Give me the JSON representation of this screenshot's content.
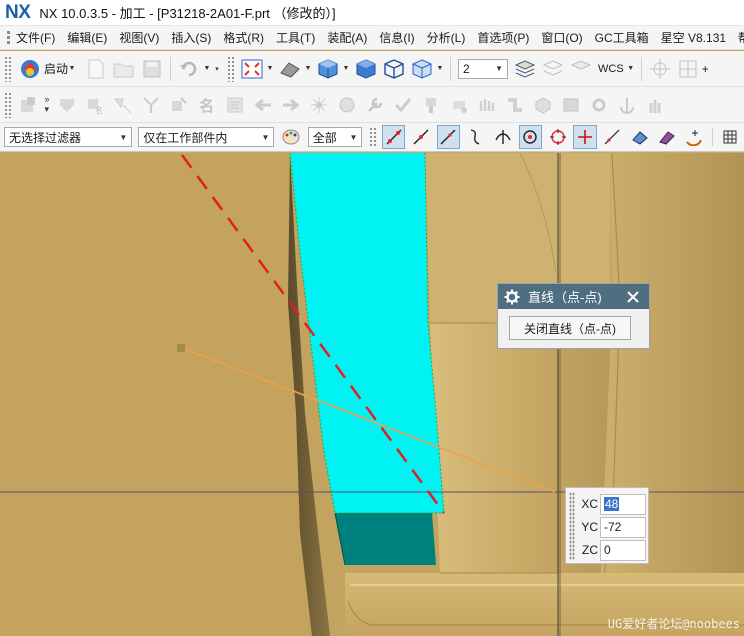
{
  "app": {
    "logo": "NX",
    "title": "NX 10.0.3.5 - 加工 - [P31218-2A01-F.prt （修改的）]"
  },
  "menu": {
    "items": [
      "文件(F)",
      "编辑(E)",
      "视图(V)",
      "插入(S)",
      "格式(R)",
      "工具(T)",
      "装配(A)",
      "信息(I)",
      "分析(L)"
    ],
    "items_right": [
      "首选项(P)",
      "窗口(O)",
      "GC工具箱",
      "星空 V8.131",
      "帮助"
    ]
  },
  "toolbar1": {
    "start_label": "启动",
    "layer_value": "2",
    "wcs_label": "WCS"
  },
  "selection_bar": {
    "filter_value": "无选择过滤器",
    "scope_value": "仅在工作部件内",
    "assembly_value": "全部"
  },
  "line_dialog": {
    "title": "直线（点-点)",
    "close_button_label": "关闭直线（点-点)"
  },
  "coords": {
    "xc_label": "XC",
    "xc_value": "48",
    "yc_label": "YC",
    "yc_value": "-72",
    "zc_label": "ZC",
    "zc_value": "0"
  },
  "watermark": "UG爱好者论坛@noobees",
  "colors": {
    "model_body": "#c8a962",
    "selected_face": "#00f5f5",
    "dark_face": "#008a8a",
    "rubber_band_line": "#f0a04a",
    "dashed_centerline": "#e02020",
    "dialog_header": "#4f6e80"
  }
}
